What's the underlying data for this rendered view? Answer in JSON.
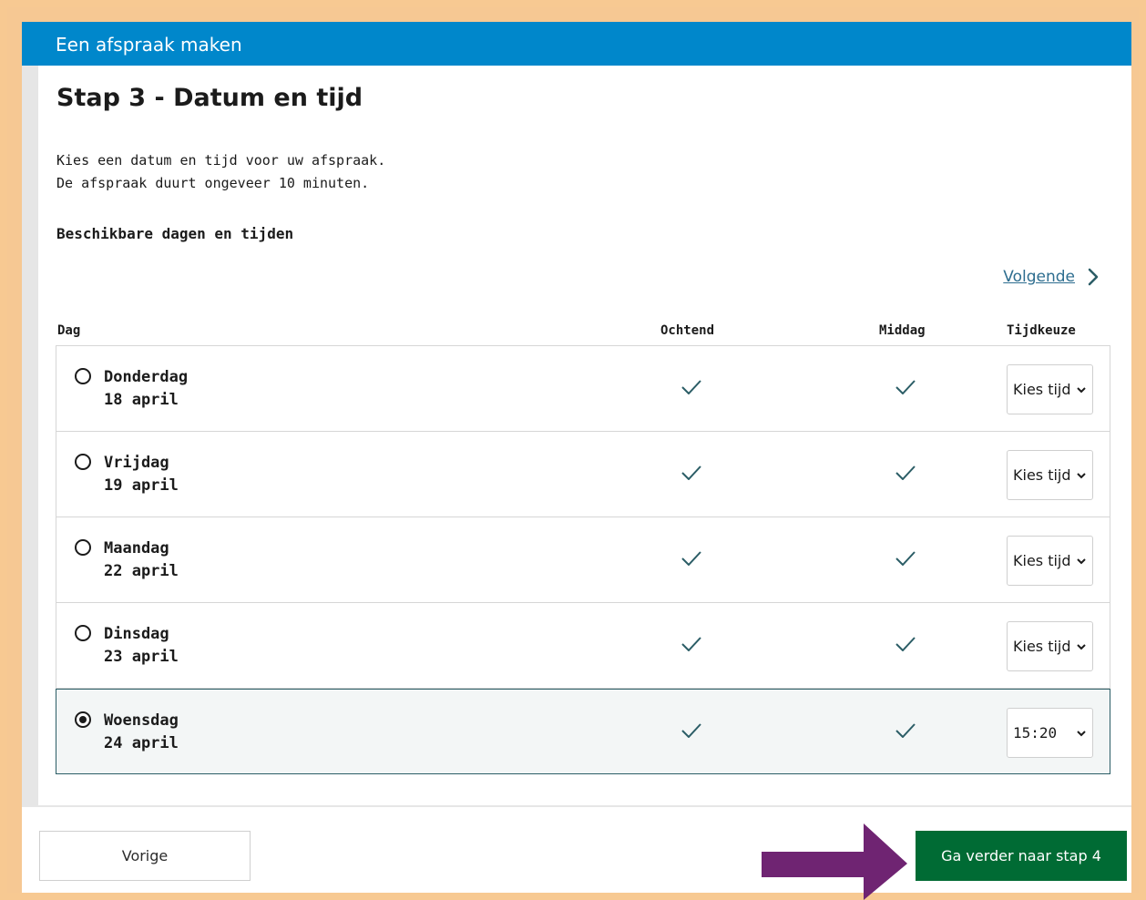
{
  "header": {
    "title": "Een afspraak maken"
  },
  "page": {
    "title": "Stap 3 - Datum en tijd",
    "intro_line1": "Kies een datum en tijd voor uw afspraak.",
    "intro_line2": "De afspraak duurt ongeveer 10 minuten.",
    "subheading": "Beschikbare dagen en tijden",
    "next_link": "Volgende"
  },
  "table": {
    "columns": {
      "day": "Dag",
      "morning": "Ochtend",
      "afternoon": "Middag",
      "time": "Tijdkeuze"
    },
    "rows": [
      {
        "day": "Donderdag",
        "date": "18 april",
        "morning": true,
        "afternoon": true,
        "time": "Kies tijd",
        "selected": false
      },
      {
        "day": "Vrijdag",
        "date": "19 april",
        "morning": true,
        "afternoon": true,
        "time": "Kies tijd",
        "selected": false
      },
      {
        "day": "Maandag",
        "date": "22 april",
        "morning": true,
        "afternoon": true,
        "time": "Kies tijd",
        "selected": false
      },
      {
        "day": "Dinsdag",
        "date": "23 april",
        "morning": true,
        "afternoon": true,
        "time": "Kies tijd",
        "selected": false
      },
      {
        "day": "Woensdag",
        "date": "24 april",
        "morning": true,
        "afternoon": true,
        "time": "15:20",
        "selected": true
      }
    ]
  },
  "footer": {
    "prev_label": "Vorige",
    "next_label": "Ga verder naar stap 4"
  },
  "colors": {
    "header": "#0087cb",
    "primary_button": "#006b34",
    "annotation_arrow": "#6f2472",
    "frame": "#f6c893",
    "check": "#2b5d66"
  },
  "icons": {
    "next_link": "chevron-right-icon",
    "check": "checkmark-icon",
    "select": "chevron-down-icon",
    "annotation": "arrow-right-icon"
  }
}
